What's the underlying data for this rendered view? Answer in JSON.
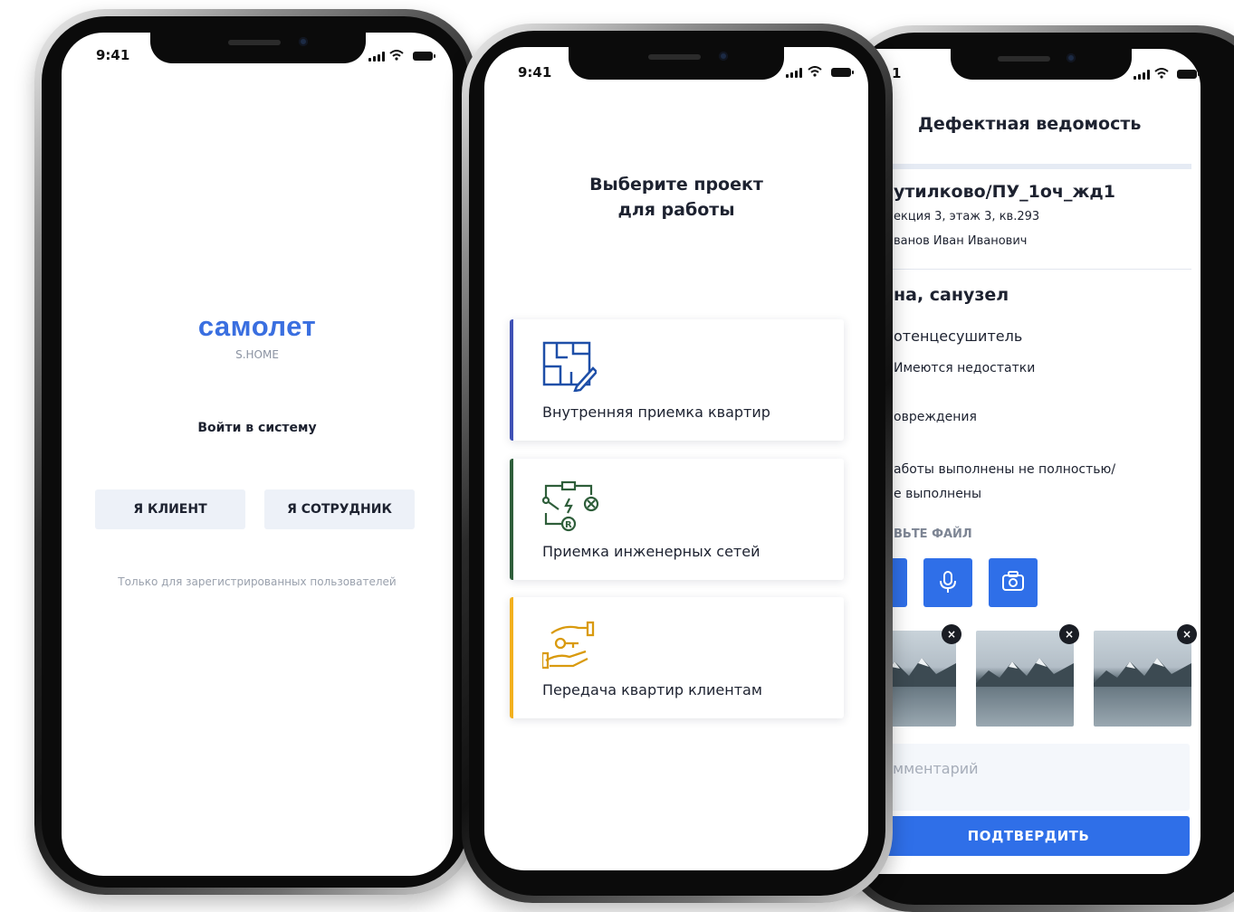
{
  "status_time": "9:41",
  "login": {
    "brand": "самолет",
    "brand_sub": "S.HOME",
    "title": "Войти в систему",
    "client_button": "Я КЛИЕНТ",
    "employee_button": "Я СОТРУДНИК",
    "note": "Только для зарегистрированных пользователей"
  },
  "projects": {
    "title_line1": "Выберите проект",
    "title_line2": "для работы",
    "items": [
      {
        "label": "Внутренняя приемка квартир",
        "accent": "#3f51b5",
        "icon": "floorplan-edit-icon"
      },
      {
        "label": "Приемка инженерных сетей",
        "accent": "#2e5e3a",
        "icon": "engineering-network-icon"
      },
      {
        "label": "Передача квартир клиентам",
        "accent": "#f2b01e",
        "icon": "key-handover-icon"
      }
    ]
  },
  "defects": {
    "status_time_fragment": "1",
    "title": "Дефектная ведомость",
    "object_name": "утилково/ПУ_1оч_жд1",
    "location": "екция 3, этаж 3, кв.293",
    "owner": "ванов Иван Иванович",
    "room": "на, санузел",
    "item": "отенцесушитель",
    "option1": "Имеются недостатки",
    "option2": "овреждения",
    "option3_line1": "аботы выполнены не полностью/",
    "option3_line2": "е выполнены",
    "attach_label": "ВЬТЕ ФАЙЛ",
    "comment_placeholder": "мментарий",
    "confirm_button": "ПОДТВЕРДИТЬ",
    "thumb_close": "×"
  },
  "colors": {
    "accent_blue": "#2f6fe8",
    "brand_blue": "#3a6fe0"
  }
}
